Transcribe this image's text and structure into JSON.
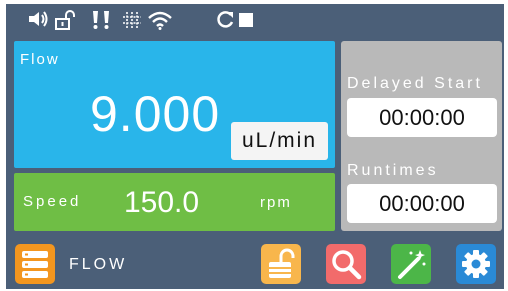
{
  "status_bar": {
    "icons": [
      "speaker-icon",
      "unlock-icon",
      "alert-icon",
      "hash-icon",
      "wifi-icon",
      "refresh-icon",
      "stop-icon"
    ]
  },
  "flow": {
    "label": "Flow",
    "value": "9.000",
    "unit": "uL/min"
  },
  "speed": {
    "label": "Speed",
    "value": "150.0",
    "unit": "rpm"
  },
  "timers": {
    "delayed_start_label": "Delayed Start",
    "delayed_start_value": "00:00:00",
    "runtimes_label": "Runtimes",
    "runtimes_value": "00:00:00"
  },
  "bottom_bar": {
    "mode_label": "FLOW",
    "buttons": [
      {
        "name": "menu-list-icon",
        "color": "#f3961f"
      },
      {
        "name": "unlock-icon",
        "color": "#f8b64c"
      },
      {
        "name": "search-icon",
        "color": "#f26b6b"
      },
      {
        "name": "magic-wand-icon",
        "color": "#4cb648"
      },
      {
        "name": "gear-icon",
        "color": "#2a8ad6"
      }
    ]
  },
  "colors": {
    "background": "#4b5f78",
    "flow_panel": "#29b5ea",
    "speed_panel": "#6fbe45",
    "timer_panel": "#b9b9b9"
  }
}
